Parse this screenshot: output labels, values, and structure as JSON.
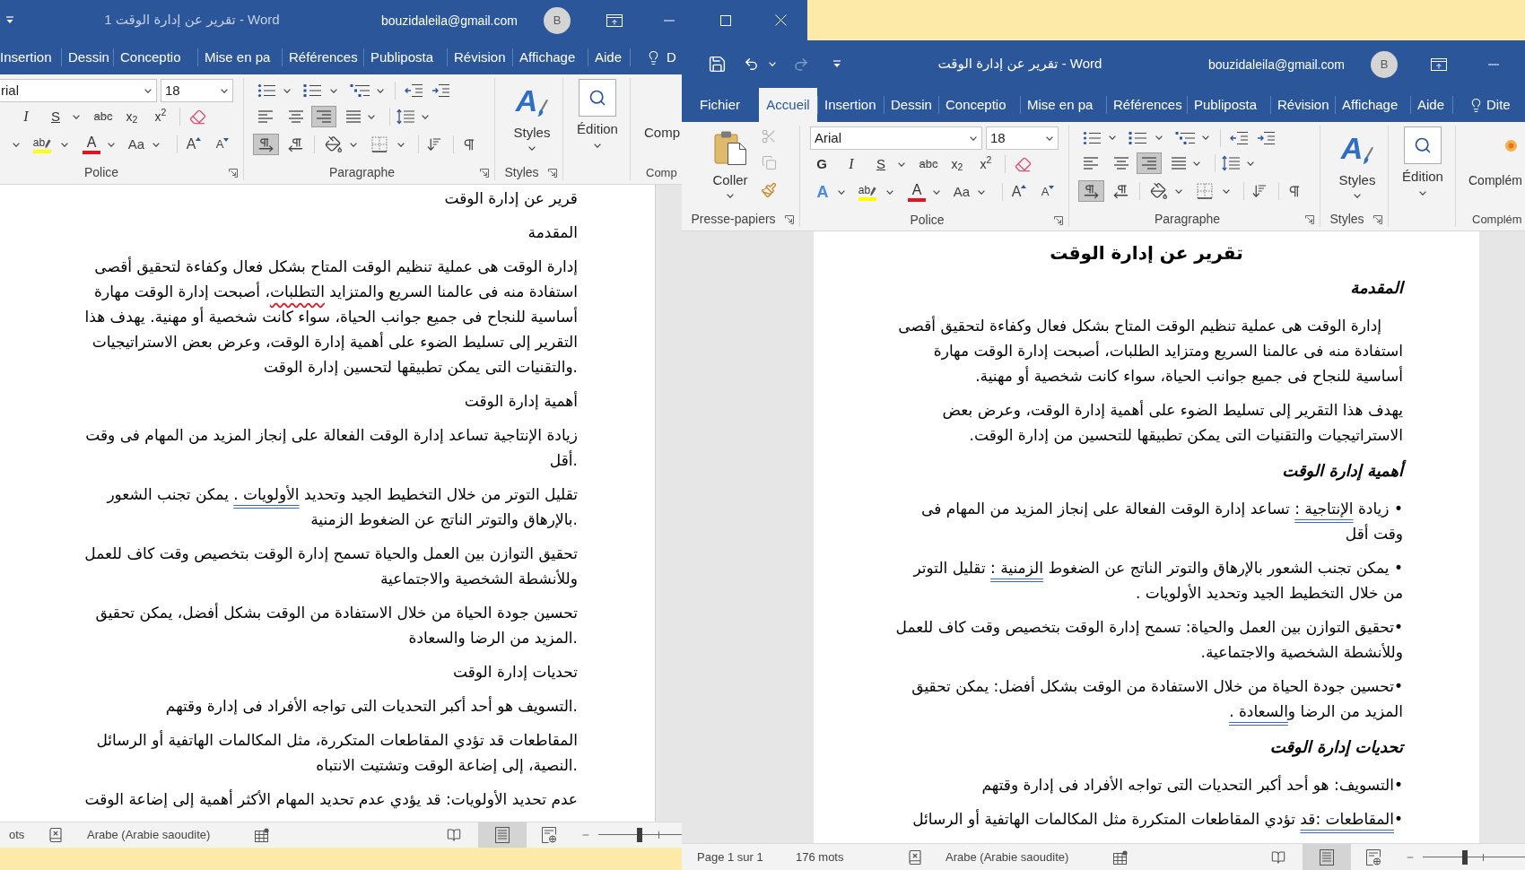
{
  "back_window": {
    "active": false,
    "title": "تقرير عن إدارة الوقت 1 - Word",
    "account": {
      "email": "bouzidaleila@gmail.com",
      "initial": "B"
    },
    "tabs": [
      {
        "label": "Aide",
        "selected": false
      },
      {
        "label": "Affichage",
        "selected": false
      },
      {
        "label": "Révision",
        "selected": false
      },
      {
        "label": "Publiposta",
        "selected": false
      },
      {
        "label": "Références",
        "selected": false
      },
      {
        "label": "Mise en pa",
        "selected": false
      },
      {
        "label": "Conceptio",
        "selected": false
      },
      {
        "label": "Dessin",
        "selected": false
      },
      {
        "label": "Insertion",
        "selected": false
      }
    ],
    "tell_me": "D",
    "ribbon": {
      "font": {
        "name": "rial",
        "size": "18",
        "format_buttons": [
          {
            "kind": "superscript",
            "label": "x$^{2}$"
          },
          {
            "kind": "subscript",
            "label": "x$_{2}$"
          },
          {
            "kind": "strikethrough",
            "label": "abc"
          },
          {
            "kind": "underline",
            "label": "S"
          },
          {
            "kind": "italic",
            "label": "I"
          }
        ],
        "color_buttons": [
          {
            "kind": "shrink",
            "label": "A"
          },
          {
            "kind": "grow",
            "label": "A"
          },
          {
            "kind": "change_case",
            "label": "Aa"
          },
          {
            "kind": "font_color",
            "label": "A"
          },
          {
            "kind": "highlight",
            "label": "ab"
          }
        ],
        "group_label": "Police"
      },
      "paragraph": {
        "alignment": [
          {
            "selected": false
          },
          {
            "selected": true
          },
          {
            "selected": false
          },
          {
            "selected": false
          }
        ],
        "direction": [
          {
            "selected": false
          },
          {
            "selected": true
          }
        ],
        "group_label": "Paragraphe"
      },
      "styles": {
        "glyph": "A",
        "button": "Styles",
        "group_label": "Styles"
      },
      "editing": {
        "button": "Édition"
      },
      "addins": {
        "button": "Comp",
        "group_label": "Comp"
      }
    },
    "document": {
      "right_to_left": false,
      "paragraphs": [
        {
          "kind": "body",
          "text": "قرير عن إدارة الوقت"
        },
        {
          "kind": "body",
          "text": "المقدمة"
        },
        {
          "kind": "body",
          "runs": [
            {
              "kind": "plain",
              "text": "إدارة الوقت هى عملية تنظيم الوقت المتاح بشكل فعال وكفاءة لتحقيق أقصى استفادة منه فى عالمنا السريع والمتزايد "
            },
            {
              "kind": "spelling",
              "text": "التطلبات"
            },
            {
              "kind": "plain",
              "text": "، أصبحت إدارة الوقت مهارة أساسية للنجاح فى جميع جوانب الحياة، سواء كانت شخصية أو مهنية. يهدف هذا التقرير إلى تسليط الضوء على أهمية إدارة الوقت، وعرض بعض الاستراتيجيات والتقنيات التى يمكن تطبيقها لتحسين إدارة الوقت."
            }
          ]
        },
        {
          "kind": "body",
          "text": "أهمية إدارة الوقت"
        },
        {
          "kind": "body",
          "text": "زيادة الإنتاجية تساعد إدارة الوقت الفعالة على إنجاز المزيد من المهام فى وقت أقل."
        },
        {
          "kind": "body",
          "runs": [
            {
              "kind": "plain",
              "text": "تقليل التوتر من خلال التخطيط الجيد وتحديد "
            },
            {
              "kind": "grammar",
              "text": "الأولويات ."
            },
            {
              "kind": "plain",
              "text": " يمكن تجنب الشعور بالإرهاق والتوتر الناتج عن الضغوط الزمنية."
            }
          ]
        },
        {
          "kind": "body",
          "text": "تحقيق التوازن بين العمل والحياة تسمح إدارة الوقت بتخصيص وقت كاف للعمل وللأنشطة الشخصية والاجتماعية"
        },
        {
          "kind": "body",
          "text": "تحسين جودة الحياة من خلال الاستفادة من الوقت بشكل أفضل، يمكن تحقيق المزيد من الرضا والسعادة."
        },
        {
          "kind": "body",
          "text": "تحديات إدارة الوقت"
        },
        {
          "kind": "body",
          "text": "التسويف هو أحد أكبر التحديات التى تواجه الأفراد فى إدارة وقتهم."
        },
        {
          "kind": "body",
          "text": "المقاطعات قد تؤدي المقاطعات المتكررة، مثل المكالمات الهاتفية أو الرسائل النصية، إلى إضاعة الوقت وتشتيت الانتباه."
        },
        {
          "kind": "body",
          "text": "عدم تحديد الأولويات: قد يؤدي عدم تحديد المهام الأكثر أهمية إلى إضاعة الوقت"
        }
      ]
    },
    "status_bar": {
      "words": "ots",
      "language": "Arabe (Arabie saoudite)",
      "views": [
        {
          "selected": false
        },
        {
          "selected": true
        },
        {
          "selected": false
        }
      ],
      "zoom": {
        "level": 0.49
      }
    }
  },
  "front_window": {
    "active": true,
    "quick_access": [
      {
        "disabled": true
      },
      {
        "disabled": false
      },
      {
        "disabled": false
      }
    ],
    "title": "تقرير عن إدارة الوقت - Word",
    "account": {
      "email": "bouzidaleila@gmail.com",
      "initial": "B"
    },
    "tabs": [
      {
        "label": "Aide",
        "selected": false
      },
      {
        "label": "Affichage",
        "selected": false
      },
      {
        "label": "Révision",
        "selected": false
      },
      {
        "label": "Publiposta",
        "selected": false
      },
      {
        "label": "Références",
        "selected": false
      },
      {
        "label": "Mise en pa",
        "selected": false
      },
      {
        "label": "Conceptio",
        "selected": false
      },
      {
        "label": "Dessin",
        "selected": false
      },
      {
        "label": "Insertion",
        "selected": false
      },
      {
        "label": "Accueil",
        "selected": true
      },
      {
        "label": "Fichier",
        "selected": false
      }
    ],
    "tell_me": "Dite",
    "ribbon": {
      "clipboard": {
        "button": "Coller",
        "tools": [
          {
            "disabled": true
          },
          {
            "disabled": true
          },
          {
            "disabled": false
          }
        ],
        "group_label": "Presse-papiers"
      },
      "font": {
        "name": "Arial",
        "size": "18",
        "format_buttons": [
          {
            "kind": "superscript",
            "label": "x$^{2}$"
          },
          {
            "kind": "subscript",
            "label": "x$_{2}$"
          },
          {
            "kind": "strikethrough",
            "label": "abc"
          },
          {
            "kind": "underline",
            "label": "S"
          },
          {
            "kind": "italic",
            "label": "I"
          },
          {
            "kind": "bold",
            "label": "G"
          }
        ],
        "color_buttons": [
          {
            "kind": "shrink",
            "label": "A"
          },
          {
            "kind": "grow",
            "label": "A"
          },
          {
            "kind": "change_case",
            "label": "Aa"
          },
          {
            "kind": "font_color",
            "label": "A"
          },
          {
            "kind": "highlight",
            "label": "ab"
          },
          {
            "kind": "text_effects",
            "label": "A"
          }
        ],
        "group_label": "Police"
      },
      "paragraph": {
        "alignment": [
          {
            "selected": false
          },
          {
            "selected": true
          },
          {
            "selected": false
          },
          {
            "selected": false
          }
        ],
        "direction": [
          {
            "selected": false
          },
          {
            "selected": true
          }
        ],
        "group_label": "Paragraphe"
      },
      "styles": {
        "glyph": "A",
        "button": "Styles",
        "group_label": "Styles"
      },
      "editing": {
        "button": "Édition"
      },
      "addins": {
        "button": "Complém",
        "group_label": "Complém"
      }
    },
    "document": {
      "right_to_left": true,
      "paragraphs": [
        {
          "kind": "title",
          "text": "تقرير عن إدارة الوقت"
        },
        {
          "kind": "heading",
          "text": "المقدمة"
        },
        {
          "kind": "body",
          "indent": true,
          "text": "إدارة الوقت هى عملية تنظيم الوقت المتاح بشكل فعال وكفاءة لتحقيق أقصى استفادة منه فى عالمنا السريع ومتزايد الطلبات، أصبحت إدارة الوقت مهارة أساسية للنجاح فى جميع جوانب الحياة، سواء كانت شخصية أو مهنية."
        },
        {
          "kind": "body",
          "text": "يهدف هذا التقرير إلى تسليط الضوء على أهمية إدارة الوقت، وعرض بعض الاستراتيجيات والتقنيات التى يمكن تطبيقها للتحسين من إدارة الوقت."
        },
        {
          "kind": "heading",
          "text": "أهمية إدارة الوقت"
        },
        {
          "kind": "body",
          "runs": [
            {
              "kind": "plain",
              "text": "• زيادة "
            },
            {
              "kind": "grammar",
              "text": "الإنتاجية :"
            },
            {
              "kind": "plain",
              "text": " تساعد إدارة الوقت الفعالة على إنجاز المزيد من المهام فى وقت أقل"
            }
          ]
        },
        {
          "kind": "body",
          "runs": [
            {
              "kind": "plain",
              "text": "• يمكن تجنب الشعور بالإرهاق والتوتر الناتج عن الضغوط "
            },
            {
              "kind": "grammar",
              "text": "الزمنية :"
            },
            {
              "kind": "plain",
              "text": " تقليل التوتر من خلال التخطيط الجيد وتحديد الأولويات ."
            }
          ]
        },
        {
          "kind": "body",
          "text": "•تحقيق التوازن بين العمل والحياة: تسمح إدارة الوقت بتخصيص وقت كاف للعمل وللأنشطة الشخصية والاجتماعية."
        },
        {
          "kind": "body",
          "runs": [
            {
              "kind": "plain",
              "text": "•تحسين جودة الحياة من خلال الاستفادة من الوقت بشكل أفضل: يمكن تحقيق المزيد من الرضا و"
            },
            {
              "kind": "grammar",
              "text": "السعادة ."
            }
          ]
        },
        {
          "kind": "heading",
          "text": "تحديات إدارة الوقت"
        },
        {
          "kind": "body",
          "text": "•التسويف: هو أحد أكبر التحديات التى تواجه الأفراد فى إدارة وقتهم"
        },
        {
          "kind": "body",
          "runs": [
            {
              "kind": "plain",
              "text": "•"
            },
            {
              "kind": "grammar",
              "text": "المقاطعات :قد"
            },
            {
              "kind": "plain",
              "text": " تؤدي المقاطعات المتكررة مثل المكالمات الهاتفية أو الرسائل"
            }
          ]
        }
      ]
    },
    "status_bar": {
      "page": "Page 1 sur 1",
      "words": "176 mots",
      "language": "Arabe (Arabie saoudite)",
      "views": [
        {
          "selected": false
        },
        {
          "selected": true
        },
        {
          "selected": false
        }
      ],
      "zoom": {
        "level": 0.41
      }
    }
  }
}
